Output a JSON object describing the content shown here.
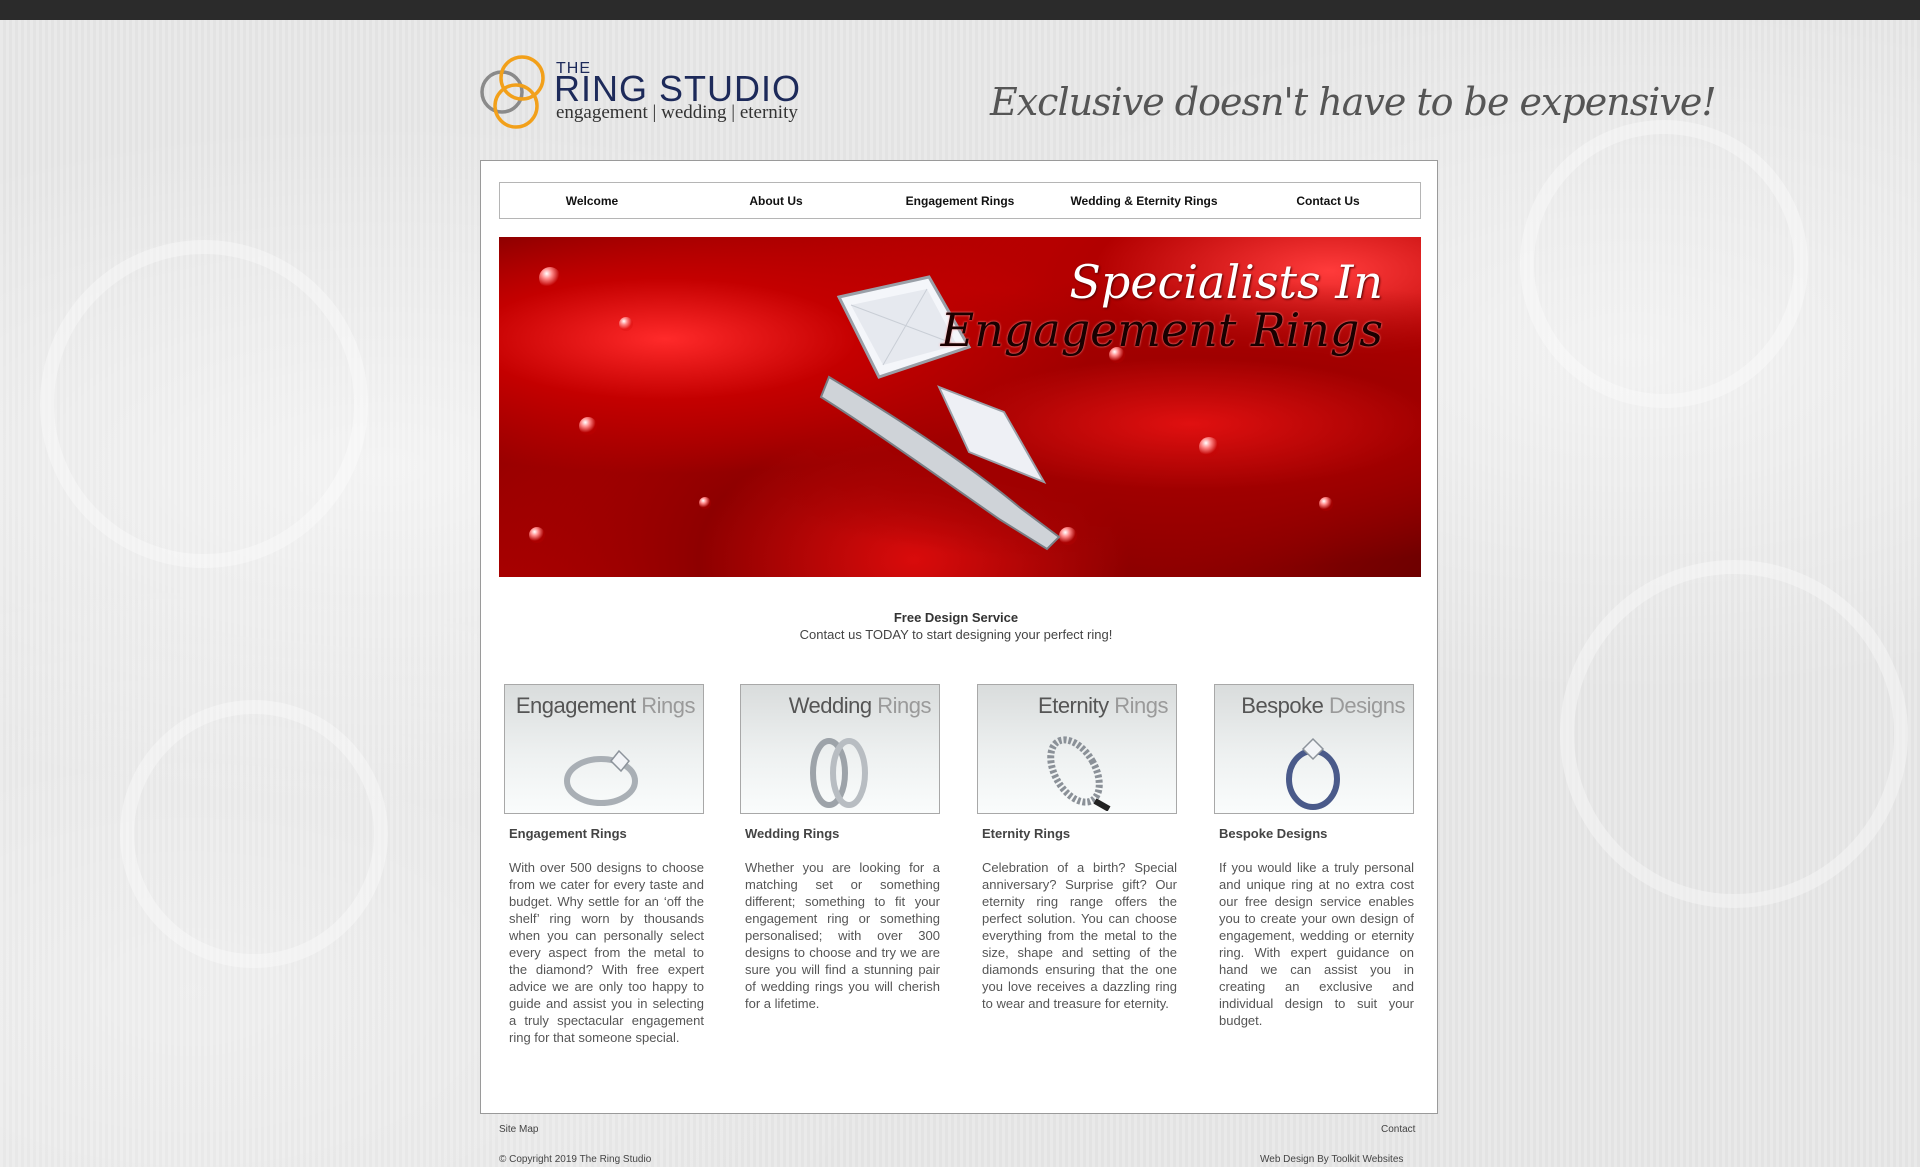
{
  "logo": {
    "the": "THE",
    "name": "RING STUDIO",
    "subtitle": "engagement | wedding | eternity"
  },
  "tagline": "Exclusive doesn't have to be expensive!",
  "nav": {
    "items": [
      {
        "label": "Welcome"
      },
      {
        "label": "About Us"
      },
      {
        "label": "Engagement Rings"
      },
      {
        "label": "Wedding & Eternity Rings"
      },
      {
        "label": "Contact Us"
      }
    ]
  },
  "hero": {
    "line1": "Specialists In",
    "line2": "Engagement Rings"
  },
  "promo": {
    "heading": "Free Design Service",
    "text": "Contact us TODAY to start designing your perfect ring!"
  },
  "products": [
    {
      "thumb_dark": "Engagement",
      "thumb_light": "Rings",
      "title": "Engagement Rings",
      "text": "With over 500 designs to choose from we cater for every taste and budget.  Why settle for an ‘off the shelf’ ring worn by thousands when you can personally select every aspect from the metal to the diamond? With free expert advice we are only too happy to guide and assist you in selecting a truly spectacular engagement ring for that someone special."
    },
    {
      "thumb_dark": "Wedding",
      "thumb_light": "Rings",
      "title": "Wedding Rings",
      "text": "Whether you are looking for a matching set or something different; something to fit your engagement ring or something personalised; with over 300 designs to choose and try we are sure you will find a stunning pair of wedding rings you will cherish for a lifetime."
    },
    {
      "thumb_dark": "Eternity",
      "thumb_light": "Rings",
      "title": "Eternity Rings",
      "text": "Celebration of a birth? Special anniversary? Surprise gift? Our eternity ring range offers the perfect solution. You can choose everything from the metal to the size, shape and setting of the diamonds ensuring that the one you love receives a dazzling ring to wear and treasure for eternity."
    },
    {
      "thumb_dark": "Bespoke",
      "thumb_light": "Designs",
      "title": "Bespoke Designs",
      "text": "If you would like a truly personal and unique ring at no extra cost our free design service enables you to create your own design of engagement, wedding or eternity ring. With expert guidance on hand we can assist you in creating an exclusive and individual design to suit your budget."
    }
  ],
  "footer": {
    "site_map": "Site Map",
    "contact": "Contact",
    "copyright": "© Copyright 2019 The Ring Studio",
    "credit": "Web Design By Toolkit Websites"
  },
  "colors": {
    "brand_navy": "#1d2a5a",
    "logo_orange": "#f2a01a",
    "hero_red": "#c40000",
    "top_bar": "#2b2b2b"
  }
}
